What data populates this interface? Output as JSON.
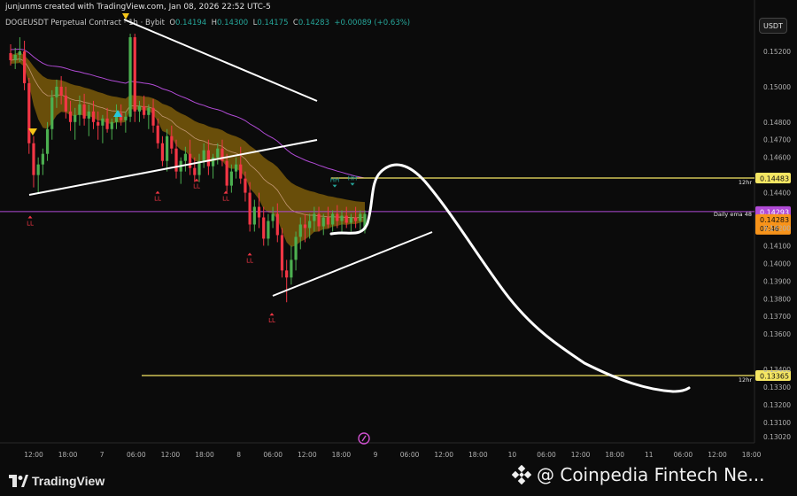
{
  "header": {
    "created_by": "junjunms created with TradingView.com, Jan 08, 2026 22:52 UTC-5"
  },
  "symbol_line": {
    "symbol": "DOGEUSDT Perpetual Contract · 1h · Bybit",
    "o_label": "O",
    "o_value": "0.14194",
    "h_label": "H",
    "h_value": "0.14300",
    "l_label": "L",
    "l_value": "0.14175",
    "c_label": "C",
    "c_value": "0.14283",
    "change": "+0.00089 (+0.63%)"
  },
  "currency_button": "USDT",
  "footer": {
    "logo_text": "TradingView",
    "watermark": "@ Coinpedia Fintech Ne..."
  },
  "colors": {
    "bull": "#4caf50",
    "bear": "#f23645",
    "ema_line": "#b14bd6",
    "level_line": "#f5e663",
    "ribbon": "#b8860b",
    "drawing": "#ffffff"
  },
  "chart_data": {
    "type": "candlestick",
    "title": "DOGEUSDT Perpetual Contract · 1h · Bybit",
    "ylim": [
      0.13,
      0.153
    ],
    "y_ticks": [
      "0.15200",
      "0.15000",
      "0.14800",
      "0.14700",
      "0.14600",
      "0.14400",
      "0.14100",
      "0.14000",
      "0.13900",
      "0.13800",
      "0.13700",
      "0.13600",
      "0.13400",
      "0.13300",
      "0.13200",
      "0.13100",
      "0.13020"
    ],
    "y_tick_values": [
      0.152,
      0.15,
      0.148,
      0.147,
      0.146,
      0.144,
      0.141,
      0.14,
      0.139,
      0.138,
      0.137,
      0.136,
      0.134,
      0.133,
      0.132,
      0.131,
      0.1302
    ],
    "x_ticks": [
      "12:00",
      "18:00",
      "7",
      "06:00",
      "12:00",
      "18:00",
      "8",
      "06:00",
      "12:00",
      "18:00",
      "9",
      "06:00",
      "12:00",
      "18:00",
      "10",
      "06:00",
      "12:00",
      "18:00",
      "11",
      "06:00",
      "12:00",
      "18:00"
    ],
    "levels": [
      {
        "value": 0.14483,
        "label": "0.14483",
        "tag": "12hr",
        "color": "#f5e663"
      },
      {
        "value": 0.13365,
        "label": "0.13365",
        "tag": "12hr",
        "color": "#f5e663"
      },
      {
        "value": 0.14293,
        "label": "0.14293",
        "tag": "Daily ema 48",
        "color": "#b14bd6"
      }
    ],
    "current_price": {
      "value": 0.14283,
      "label": "0.14283",
      "countdown": "07:46"
    },
    "y_label_extra": [
      "0.14200"
    ],
    "pivot_labels": [
      {
        "text": "LL",
        "x": 34,
        "price": 0.1427
      },
      {
        "text": "LL",
        "x": 178,
        "price": 0.1441
      },
      {
        "text": "LL",
        "x": 222,
        "price": 0.1448
      },
      {
        "text": "LL",
        "x": 255,
        "price": 0.1441
      },
      {
        "text": "LL",
        "x": 282,
        "price": 0.1406
      },
      {
        "text": "LL",
        "x": 307,
        "price": 0.1372
      },
      {
        "text": "HH",
        "x": 378,
        "price": 0.1443
      },
      {
        "text": "HH",
        "x": 398,
        "price": 0.1444
      }
    ],
    "candles": [
      [
        0.1519,
        0.1524,
        0.1512,
        0.1515
      ],
      [
        0.1515,
        0.1522,
        0.151,
        0.1518
      ],
      [
        0.1518,
        0.1528,
        0.1514,
        0.152
      ],
      [
        0.152,
        0.1526,
        0.1498,
        0.1502
      ],
      [
        0.1502,
        0.1505,
        0.1462,
        0.1468
      ],
      [
        0.1468,
        0.1472,
        0.1443,
        0.145
      ],
      [
        0.145,
        0.146,
        0.144,
        0.1456
      ],
      [
        0.1456,
        0.1465,
        0.145,
        0.1462
      ],
      [
        0.1462,
        0.148,
        0.1458,
        0.1476
      ],
      [
        0.1476,
        0.1498,
        0.147,
        0.1494
      ],
      [
        0.1494,
        0.1504,
        0.1488,
        0.15
      ],
      [
        0.15,
        0.1506,
        0.149,
        0.1495
      ],
      [
        0.1495,
        0.15,
        0.1482,
        0.1486
      ],
      [
        0.1486,
        0.1492,
        0.1475,
        0.148
      ],
      [
        0.148,
        0.1488,
        0.147,
        0.1484
      ],
      [
        0.1484,
        0.1495,
        0.1478,
        0.149
      ],
      [
        0.149,
        0.1496,
        0.1478,
        0.1482
      ],
      [
        0.1482,
        0.149,
        0.1472,
        0.1486
      ],
      [
        0.1486,
        0.1492,
        0.1476,
        0.148
      ],
      [
        0.148,
        0.1486,
        0.147,
        0.1478
      ],
      [
        0.1478,
        0.1484,
        0.1468,
        0.1482
      ],
      [
        0.1482,
        0.1488,
        0.1474,
        0.1476
      ],
      [
        0.1476,
        0.1482,
        0.147,
        0.148
      ],
      [
        0.148,
        0.149,
        0.1476,
        0.1485
      ],
      [
        0.1485,
        0.149,
        0.1478,
        0.1481
      ],
      [
        0.1481,
        0.1486,
        0.1474,
        0.1483
      ],
      [
        0.1483,
        0.153,
        0.148,
        0.1528
      ],
      [
        0.1528,
        0.153,
        0.148,
        0.1486
      ],
      [
        0.1486,
        0.1492,
        0.148,
        0.1489
      ],
      [
        0.1489,
        0.1495,
        0.1482,
        0.1484
      ],
      [
        0.1484,
        0.149,
        0.1476,
        0.1488
      ],
      [
        0.1488,
        0.1493,
        0.1474,
        0.1478
      ],
      [
        0.1478,
        0.1482,
        0.1465,
        0.1468
      ],
      [
        0.1468,
        0.1472,
        0.1455,
        0.1458
      ],
      [
        0.1458,
        0.1476,
        0.1452,
        0.1472
      ],
      [
        0.1472,
        0.1478,
        0.1462,
        0.1465
      ],
      [
        0.1465,
        0.147,
        0.1448,
        0.1452
      ],
      [
        0.1452,
        0.146,
        0.1445,
        0.1458
      ],
      [
        0.1458,
        0.1466,
        0.1452,
        0.1462
      ],
      [
        0.1462,
        0.147,
        0.145,
        0.1454
      ],
      [
        0.1454,
        0.146,
        0.1446,
        0.145
      ],
      [
        0.145,
        0.1462,
        0.1446,
        0.1458
      ],
      [
        0.1458,
        0.1468,
        0.1454,
        0.1464
      ],
      [
        0.1464,
        0.147,
        0.145,
        0.1455
      ],
      [
        0.1455,
        0.1462,
        0.1448,
        0.146
      ],
      [
        0.146,
        0.1468,
        0.1456,
        0.1465
      ],
      [
        0.1465,
        0.147,
        0.1455,
        0.1458
      ],
      [
        0.1458,
        0.1462,
        0.144,
        0.1444
      ],
      [
        0.1444,
        0.1456,
        0.144,
        0.1452
      ],
      [
        0.1452,
        0.146,
        0.1448,
        0.1456
      ],
      [
        0.1456,
        0.1466,
        0.1445,
        0.1448
      ],
      [
        0.1448,
        0.1452,
        0.1435,
        0.144
      ],
      [
        0.144,
        0.1446,
        0.1418,
        0.1422
      ],
      [
        0.1422,
        0.1436,
        0.1418,
        0.1432
      ],
      [
        0.1432,
        0.144,
        0.142,
        0.1426
      ],
      [
        0.1426,
        0.1432,
        0.141,
        0.1414
      ],
      [
        0.1414,
        0.1428,
        0.141,
        0.1424
      ],
      [
        0.1424,
        0.1432,
        0.142,
        0.1428
      ],
      [
        0.1428,
        0.1434,
        0.1412,
        0.1416
      ],
      [
        0.1416,
        0.142,
        0.1392,
        0.1396
      ],
      [
        0.1396,
        0.1402,
        0.1378,
        0.1392
      ],
      [
        0.1392,
        0.141,
        0.1388,
        0.1402
      ],
      [
        0.1402,
        0.1418,
        0.1396,
        0.1415
      ],
      [
        0.1415,
        0.1426,
        0.1408,
        0.1422
      ],
      [
        0.1422,
        0.1428,
        0.1412,
        0.142
      ],
      [
        0.142,
        0.1428,
        0.1414,
        0.1424
      ],
      [
        0.1424,
        0.1432,
        0.1418,
        0.1428
      ],
      [
        0.1428,
        0.1432,
        0.1418,
        0.1421
      ],
      [
        0.1421,
        0.1428,
        0.1416,
        0.1426
      ],
      [
        0.1426,
        0.1432,
        0.142,
        0.1422
      ],
      [
        0.1422,
        0.143,
        0.1418,
        0.1428
      ],
      [
        0.1428,
        0.1433,
        0.142,
        0.1424
      ],
      [
        0.1424,
        0.143,
        0.1418,
        0.1427
      ],
      [
        0.1427,
        0.1432,
        0.142,
        0.1423
      ],
      [
        0.1423,
        0.1428,
        0.1418,
        0.1426
      ],
      [
        0.1426,
        0.1432,
        0.142,
        0.1424
      ],
      [
        0.1424,
        0.143,
        0.1418,
        0.1428
      ],
      [
        0.1419,
        0.143,
        0.1417,
        0.1428
      ]
    ],
    "ema_points": [
      [
        0.1508
      ],
      [
        0.1504
      ],
      [
        0.1498
      ],
      [
        0.149
      ],
      [
        0.1482
      ],
      [
        0.1474
      ],
      [
        0.1468
      ],
      [
        0.1462
      ],
      [
        0.1456
      ],
      [
        0.145
      ],
      [
        0.1444
      ],
      [
        0.144
      ],
      [
        0.1436
      ],
      [
        0.1432
      ]
    ]
  }
}
